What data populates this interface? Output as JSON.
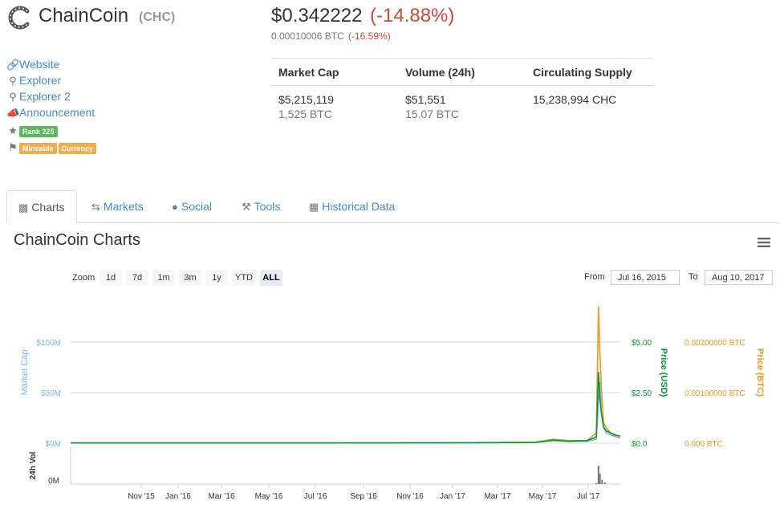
{
  "coin": {
    "name": "ChainCoin",
    "symbol": "(CHC)",
    "price_usd": "$0.342222",
    "change_usd": "(-14.88%)",
    "price_btc": "0.00010006 BTC",
    "change_btc": "(-16.59%)"
  },
  "links": [
    {
      "icon": "link-icon",
      "label": "Website"
    },
    {
      "icon": "search-icon",
      "label": "Explorer"
    },
    {
      "icon": "search-icon",
      "label": "Explorer 2"
    },
    {
      "icon": "bullhorn-icon",
      "label": "Announcement"
    }
  ],
  "badges": {
    "rank": "Rank 225",
    "tags": [
      "Mineable",
      "Currency"
    ]
  },
  "stats": {
    "headers": [
      "Market Cap",
      "Volume (24h)",
      "Circulating Supply"
    ],
    "market_cap": {
      "usd": "$5,215,119",
      "btc": "1,525 BTC"
    },
    "volume": {
      "usd": "$51,551",
      "btc": "15.07 BTC"
    },
    "supply": "15,238,994 CHC"
  },
  "tabs": [
    {
      "icon": "bar-chart-icon",
      "label": "Charts",
      "active": true
    },
    {
      "icon": "exchange-icon",
      "label": "Markets"
    },
    {
      "icon": "globe-icon",
      "label": "Social"
    },
    {
      "icon": "wrench-icon",
      "label": "Tools"
    },
    {
      "icon": "calendar-icon",
      "label": "Historical Data"
    }
  ],
  "chart_panel": {
    "title": "ChainCoin Charts",
    "zoom_label": "Zoom",
    "zoom_buttons": [
      "1d",
      "7d",
      "1m",
      "3m",
      "1y",
      "YTD",
      "ALL"
    ],
    "zoom_selected": "ALL",
    "from_label": "From",
    "from_value": "Jul 16, 2015",
    "to_label": "To",
    "to_value": "Aug 10, 2017"
  },
  "colors": {
    "market_cap": "#7cb5ec",
    "price_usd": "#009933",
    "price_btc": "#f7931a",
    "volume": "#777777",
    "negative": "#d14836",
    "link": "#428bca"
  },
  "chart_data": {
    "type": "line",
    "x_ticks": [
      "Nov '15",
      "Jan '16",
      "Mar '16",
      "May '16",
      "Jul '16",
      "Sep '16",
      "Nov '16",
      "Jan '17",
      "Mar '17",
      "May '17",
      "Jul '17"
    ],
    "y_left": {
      "label": "Market Cap",
      "ticks": [
        "$100M",
        "$50M",
        "$0M"
      ]
    },
    "y_usd": {
      "label": "Price (USD)",
      "ticks": [
        "$5.00",
        "$2.50",
        "$0.0"
      ]
    },
    "y_btc": {
      "label": "Price (BTC)",
      "ticks": [
        "0.00200000 BTC",
        "0.00100000 BTC",
        "0.000 BTC"
      ]
    },
    "volume_axis": {
      "label": "24h Vol",
      "ticks": [
        "0M"
      ]
    },
    "series": [
      {
        "name": "Market Cap",
        "color": "#7cb5ec",
        "x": [
          "2015-07-16",
          "2016-01-01",
          "2016-07-01",
          "2017-01-01",
          "2017-04-15",
          "2017-05-10",
          "2017-06-01",
          "2017-06-25",
          "2017-07-08",
          "2017-07-11",
          "2017-07-13",
          "2017-07-15",
          "2017-07-18",
          "2017-07-22",
          "2017-07-28",
          "2017-08-04",
          "2017-08-10"
        ],
        "y": [
          0.2,
          0.2,
          0.2,
          0.3,
          0.6,
          2.5,
          1.5,
          1.8,
          4,
          40,
          60,
          30,
          15,
          10,
          8,
          6,
          5.2
        ]
      },
      {
        "name": "Price (USD)",
        "color": "#009933",
        "x": [
          "2015-07-16",
          "2016-01-01",
          "2016-07-01",
          "2017-01-01",
          "2017-04-15",
          "2017-05-10",
          "2017-06-01",
          "2017-06-25",
          "2017-07-08",
          "2017-07-11",
          "2017-07-13",
          "2017-07-15",
          "2017-07-18",
          "2017-07-22",
          "2017-07-28",
          "2017-08-04",
          "2017-08-10"
        ],
        "y": [
          0.01,
          0.01,
          0.01,
          0.02,
          0.04,
          0.15,
          0.1,
          0.12,
          0.3,
          3.5,
          2.2,
          1.5,
          0.8,
          0.6,
          0.5,
          0.4,
          0.34
        ]
      },
      {
        "name": "Price (BTC)",
        "color": "#f7931a",
        "x": [
          "2015-07-16",
          "2016-01-01",
          "2016-07-01",
          "2017-01-01",
          "2017-04-15",
          "2017-05-10",
          "2017-06-01",
          "2017-06-25",
          "2017-07-08",
          "2017-07-11",
          "2017-07-13",
          "2017-07-15",
          "2017-07-18",
          "2017-07-22",
          "2017-07-28",
          "2017-08-04",
          "2017-08-10"
        ],
        "y": [
          4e-06,
          4e-06,
          4e-06,
          6e-06,
          2e-05,
          8e-05,
          5e-05,
          5e-05,
          0.0002,
          0.0027,
          0.0018,
          0.0011,
          0.0004,
          0.0003,
          0.0002,
          0.00013,
          0.0001
        ]
      },
      {
        "name": "24h Vol",
        "color": "#777777",
        "x": [
          "2015-07-16",
          "2017-05-01",
          "2017-07-08",
          "2017-07-11",
          "2017-07-13",
          "2017-07-16",
          "2017-07-20",
          "2017-08-10"
        ],
        "y": [
          0.001,
          0.02,
          0.2,
          3.5,
          2.0,
          0.8,
          0.3,
          0.05
        ]
      }
    ],
    "grid": true
  }
}
